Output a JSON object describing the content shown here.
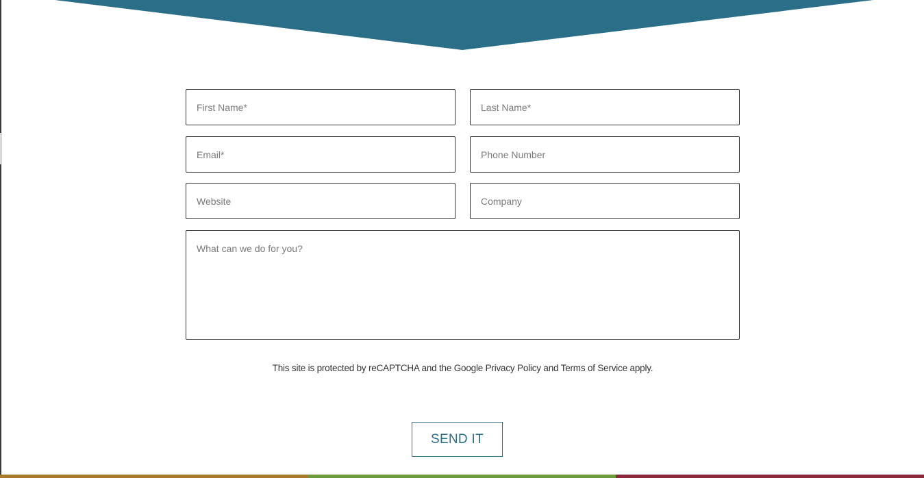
{
  "colors": {
    "banner": "#2a6e87",
    "button": "#2a6e87",
    "strip": [
      "#a97a2e",
      "#6c9a3c",
      "#8b2a3e"
    ]
  },
  "form": {
    "first_name_placeholder": "First Name*",
    "last_name_placeholder": "Last Name*",
    "email_placeholder": "Email*",
    "phone_placeholder": "Phone Number",
    "website_placeholder": "Website",
    "company_placeholder": "Company",
    "message_placeholder": "What can we do for you?"
  },
  "recaptcha": {
    "prefix": "This site is protected by reCAPTCHA and the Google ",
    "privacy_link": "Privacy Policy",
    "middle": " and ",
    "terms_link": "Terms of Service",
    "suffix": " apply."
  },
  "submit_label": "SEND IT"
}
